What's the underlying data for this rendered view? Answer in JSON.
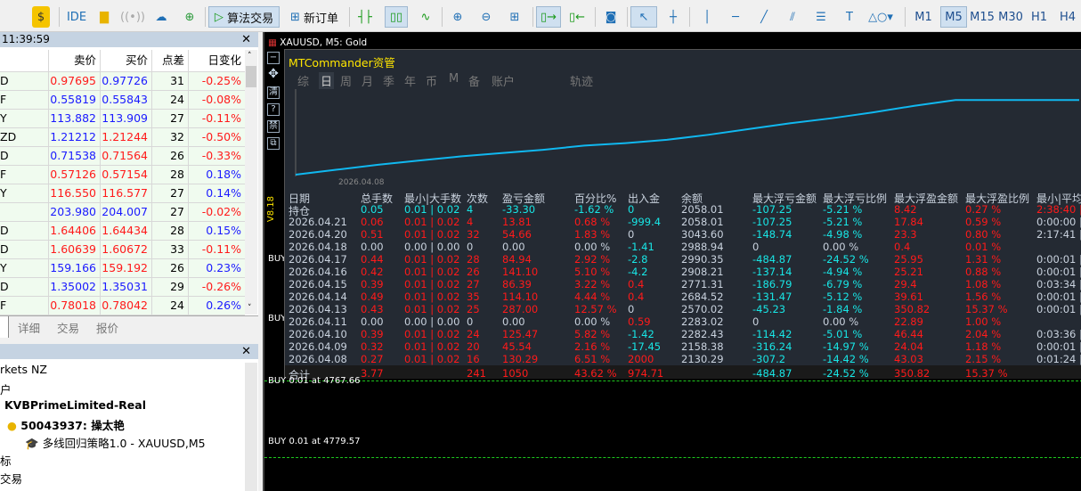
{
  "toolbar": {
    "ide": "IDE",
    "algo": "算法交易",
    "new_order": "新订单",
    "timeframes": [
      "M1",
      "M5",
      "M15",
      "M30",
      "H1",
      "H4"
    ],
    "active_tf": "M5"
  },
  "market_watch": {
    "time": "11:39:59",
    "headers": [
      "",
      "卖价",
      "买价",
      "点差",
      "日变化"
    ],
    "rows": [
      [
        "D",
        "0.97695",
        "0.97726",
        "31",
        "-0.25%"
      ],
      [
        "F",
        "0.55819",
        "0.55843",
        "24",
        "-0.08%"
      ],
      [
        "Y",
        "113.882",
        "113.909",
        "27",
        "-0.11%"
      ],
      [
        "ZD",
        "1.21212",
        "1.21244",
        "32",
        "-0.50%"
      ],
      [
        "D",
        "0.71538",
        "0.71564",
        "26",
        "-0.33%"
      ],
      [
        "F",
        "0.57126",
        "0.57154",
        "28",
        "0.18%"
      ],
      [
        "Y",
        "116.550",
        "116.577",
        "27",
        "0.14%"
      ],
      [
        "",
        "203.980",
        "204.007",
        "27",
        "-0.02%"
      ],
      [
        "D",
        "1.64406",
        "1.64434",
        "28",
        "0.15%"
      ],
      [
        "D",
        "1.60639",
        "1.60672",
        "33",
        "-0.11%"
      ],
      [
        "Y",
        "159.166",
        "159.192",
        "26",
        "0.23%"
      ],
      [
        "D",
        "1.35002",
        "1.35031",
        "29",
        "-0.26%"
      ],
      [
        "F",
        "0.78018",
        "0.78042",
        "24",
        "0.26%"
      ]
    ],
    "colors": [
      [
        "r",
        "b",
        "r"
      ],
      [
        "b",
        "b",
        "r"
      ],
      [
        "b",
        "b",
        "r"
      ],
      [
        "b",
        "r",
        "r"
      ],
      [
        "b",
        "r",
        "r"
      ],
      [
        "r",
        "r",
        "b"
      ],
      [
        "r",
        "r",
        "b"
      ],
      [
        "b",
        "b",
        "r"
      ],
      [
        "r",
        "r",
        "b"
      ],
      [
        "r",
        "r",
        "r"
      ],
      [
        "b",
        "r",
        "b"
      ],
      [
        "b",
        "b",
        "r"
      ],
      [
        "r",
        "r",
        "b"
      ]
    ],
    "tabs": [
      "详细",
      "交易",
      "报价"
    ]
  },
  "navigator": {
    "broker": "rkets NZ",
    "item1": "户",
    "server": "KVBPrimeLimited-Real",
    "account": "50043937: 操太艳",
    "ea": "多线回归策略1.0 - XAUUSD,M5",
    "item2": "标",
    "item3": "交易"
  },
  "chart": {
    "title": "XAUUSD, M5:  Gold",
    "version": "V8.18",
    "buy_labels": [
      "BUY",
      "BUY",
      "BUY 0.01 at 4767.66",
      "BUY 0.01 at 4779.57"
    ]
  },
  "mtc": {
    "title": "MTCommander资管",
    "tabs": [
      "综",
      "日",
      "周",
      "月",
      "季",
      "年",
      "币",
      "M",
      "备",
      "账户",
      "轨迹"
    ],
    "active_tab": "日",
    "equity_start_label": "2026.04.08",
    "equity_curve": [
      0,
      0.06,
      0.12,
      0.17,
      0.22,
      0.26,
      0.3,
      0.35,
      0.38,
      0.42,
      0.48,
      0.55,
      0.62,
      0.68,
      0.75,
      0.83,
      0.9,
      0.9,
      0.9,
      0.9
    ],
    "headers": [
      "日期",
      "总手数",
      "最小|大手数",
      "次数",
      "盈亏金额",
      "百分比%",
      "出入金",
      "余额",
      "最大浮亏金额",
      "最大浮亏比例",
      "最大浮盈金额",
      "最大浮盈比例",
      "最小|平均"
    ],
    "rows": [
      [
        "持仓",
        "0.05",
        "0.01 | 0.02",
        "4",
        "-33.30",
        "-1.62 %",
        "0",
        "2058.01",
        "-107.25",
        "-5.21 %",
        "8.42",
        "0.27 %",
        "2:38:40 | 4"
      ],
      [
        "2026.04.21",
        "0.06",
        "0.01 | 0.02",
        "4",
        "13.81",
        "0.68 %",
        "-999.4",
        "2058.01",
        "-107.25",
        "-5.21 %",
        "17.84",
        "0.59 %",
        "0:00:00 | 4"
      ],
      [
        "2026.04.20",
        "0.51",
        "0.01 | 0.02",
        "32",
        "54.66",
        "1.83 %",
        "0",
        "3043.60",
        "-148.74",
        "-4.98 %",
        "23.3",
        "0.80 %",
        "2:17:41 | 2"
      ],
      [
        "2026.04.18",
        "0.00",
        "0.00 | 0.00",
        "0",
        "0.00",
        "0.00 %",
        "-1.41",
        "2988.94",
        "0",
        "0.00 %",
        "0.4",
        "0.01 %",
        ""
      ],
      [
        "2026.04.17",
        "0.44",
        "0.01 | 0.02",
        "28",
        "84.94",
        "2.92 %",
        "-2.8",
        "2990.35",
        "-484.87",
        "-24.52 %",
        "25.95",
        "1.31 %",
        "0:00:01 | 4"
      ],
      [
        "2026.04.16",
        "0.42",
        "0.01 | 0.02",
        "26",
        "141.10",
        "5.10 %",
        "-4.2",
        "2908.21",
        "-137.14",
        "-4.94 %",
        "25.21",
        "0.88 %",
        "0:00:01 | 1"
      ],
      [
        "2026.04.15",
        "0.39",
        "0.01 | 0.02",
        "27",
        "86.39",
        "3.22 %",
        "0.4",
        "2771.31",
        "-186.79",
        "-6.79 %",
        "29.4",
        "1.08 %",
        "0:03:34 | 2"
      ],
      [
        "2026.04.14",
        "0.49",
        "0.01 | 0.02",
        "35",
        "114.10",
        "4.44 %",
        "0.4",
        "2684.52",
        "-131.47",
        "-5.12 %",
        "39.61",
        "1.56 %",
        "0:00:01 | 1"
      ],
      [
        "2026.04.13",
        "0.43",
        "0.01 | 0.02",
        "25",
        "287.00",
        "12.57 %",
        "0",
        "2570.02",
        "-45.23",
        "-1.84 %",
        "350.82",
        "15.37 %",
        "0:00:01 | 5"
      ],
      [
        "2026.04.11",
        "0.00",
        "0.00 | 0.00",
        "0",
        "0.00",
        "0.00 %",
        "0.59",
        "2283.02",
        "0",
        "0.00 %",
        "22.89",
        "1.00 %",
        ""
      ],
      [
        "2026.04.10",
        "0.39",
        "0.01 | 0.02",
        "24",
        "125.47",
        "5.82 %",
        "-1.42",
        "2282.43",
        "-114.42",
        "-5.01 %",
        "46.44",
        "2.04 %",
        "0:03:36 | 0"
      ],
      [
        "2026.04.09",
        "0.32",
        "0.01 | 0.02",
        "20",
        "45.54",
        "2.16 %",
        "-17.45",
        "2158.38",
        "-316.24",
        "-14.97 %",
        "24.04",
        "1.18 %",
        "0:00:01 | 4"
      ],
      [
        "2026.04.08",
        "0.27",
        "0.01 | 0.02",
        "16",
        "130.29",
        "6.51 %",
        "2000",
        "2130.29",
        "-307.2",
        "-14.42 %",
        "43.03",
        "2.15 %",
        "0:01:24 | 0"
      ],
      [
        "合计",
        "3.77",
        "",
        "241",
        "1050",
        "43.62 %",
        "974.71",
        "",
        "-484.87",
        "-24.52 %",
        "350.82",
        "15.37 %",
        ""
      ]
    ]
  }
}
